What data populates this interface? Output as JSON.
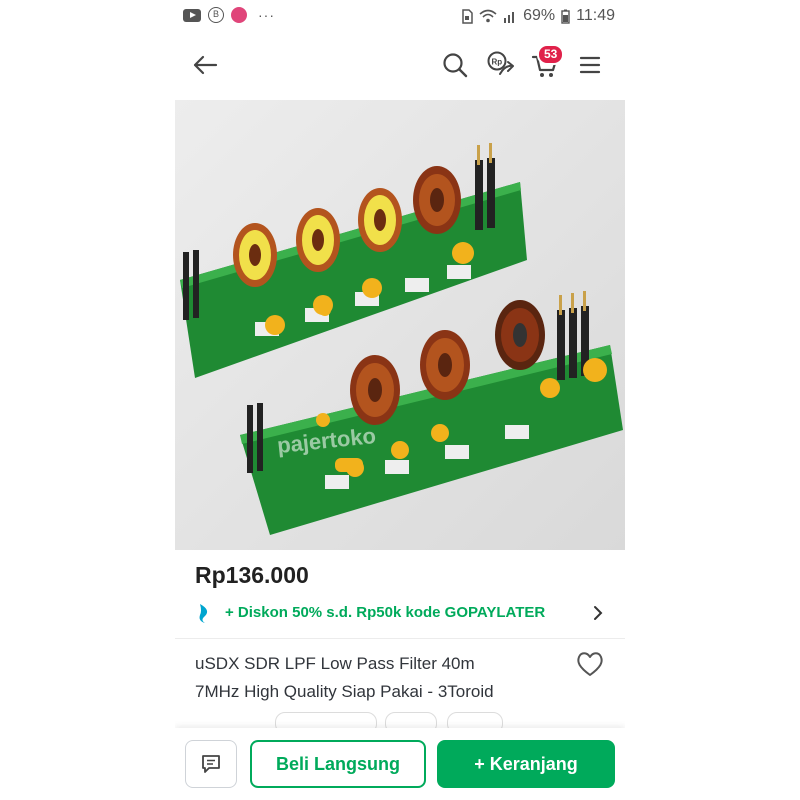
{
  "status_bar": {
    "battery": "69%",
    "time": "11:49",
    "left_icons": [
      "youtube-icon",
      "b-icon",
      "app-icon",
      "more-dots-icon"
    ],
    "right_icons": [
      "sim-icon",
      "wifi-icon",
      "signal-icon",
      "battery-icon"
    ]
  },
  "header": {
    "cart_count": "53",
    "icons": [
      "back-arrow-icon",
      "search-icon",
      "share-rp-icon",
      "cart-icon",
      "menu-icon"
    ]
  },
  "product": {
    "image_alt": "uSDX SDR LPF board photo",
    "watermark": "pajertoko",
    "price": "Rp136.000",
    "promo": "+ Diskon 50% s.d. Rp50k kode GOPAYLATER",
    "title_line1": "uSDX SDR LPF Low Pass Filter 40m",
    "title_line2": "7MHz High Quality Siap Pakai - 3Toroid"
  },
  "actions": {
    "buy_now": "Beli Langsung",
    "add_to_cart": "+ Keranjang"
  },
  "colors": {
    "accent": "#00aa5b",
    "badge": "#e0214a",
    "pcb": "#2c9a3b"
  }
}
